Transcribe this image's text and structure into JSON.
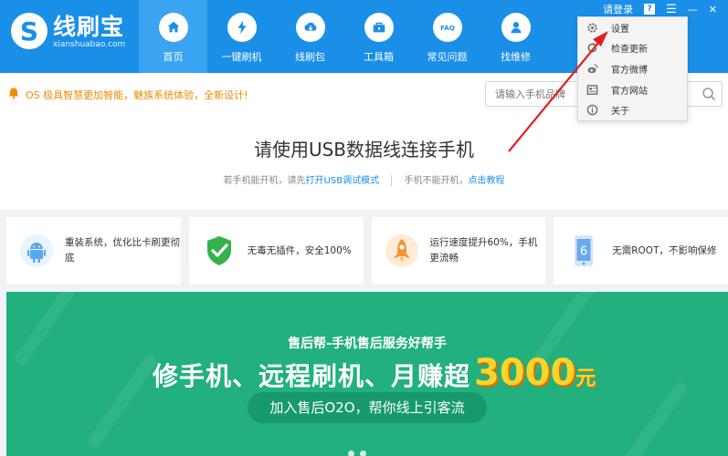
{
  "app": {
    "name": "线刷宝",
    "domain": "xianshuabao.com",
    "logo_letter": "S"
  },
  "nav": [
    {
      "label": "首页",
      "icon": "home-icon",
      "active": true
    },
    {
      "label": "一键刷机",
      "icon": "lightning-icon",
      "active": false
    },
    {
      "label": "线刷包",
      "icon": "cloud-download-icon",
      "active": false
    },
    {
      "label": "工具箱",
      "icon": "toolbox-icon",
      "active": false
    },
    {
      "label": "常见问题",
      "icon": "faq-icon",
      "active": false
    },
    {
      "label": "找维修",
      "icon": "repair-person-icon",
      "active": false
    }
  ],
  "window_controls": {
    "login_label": "请登录",
    "help_glyph": "?",
    "menu_glyph": "☰",
    "minimize_glyph": "—",
    "close_glyph": "✕"
  },
  "dropdown_menu": {
    "items": [
      {
        "label": "设置",
        "icon": "gear-icon"
      },
      {
        "label": "检查更新",
        "icon": "refresh-icon"
      },
      {
        "label": "官方微博",
        "icon": "weibo-icon"
      },
      {
        "label": "官方网站",
        "icon": "website-icon"
      },
      {
        "label": "关于",
        "icon": "info-icon"
      }
    ]
  },
  "notice": {
    "text": "OS 极具智慧更加智能，魅族系统体验，全新设计!",
    "icon": "bell-icon"
  },
  "search": {
    "placeholder": "请输入手机品牌"
  },
  "connect": {
    "title": "请使用USB数据线连接手机",
    "hint_prefix": "若手机能开机，请先",
    "hint_link": "打开USB调试模式",
    "hint2_prefix": "手机不能开机，",
    "hint2_link": "点击教程"
  },
  "features": [
    {
      "text": "重装系统，优化比卡刷更彻底",
      "icon": "android-icon"
    },
    {
      "text": "无毒无插件，安全100%",
      "icon": "shield-check-icon"
    },
    {
      "text": "运行速度提升60%，手机更流畅",
      "icon": "rocket-icon"
    },
    {
      "text": "无需ROOT，不影响保修",
      "icon": "phone-icon"
    }
  ],
  "banner": {
    "line1": "售后帮-手机售后服务好帮手",
    "line2_main": "修手机、远程刷机、月赚超",
    "line2_number": "3000",
    "line2_unit": "元",
    "pill_text": "加入售后O2O，帮你线上引客流"
  },
  "colors": {
    "header_blue": "#1a8fe8",
    "nav_active": "#3aa4f2",
    "banner_green": "#21b07e",
    "accent_orange": "#f08a00",
    "highlight_yellow": "#ffd42a",
    "arrow_red": "#e02020"
  }
}
